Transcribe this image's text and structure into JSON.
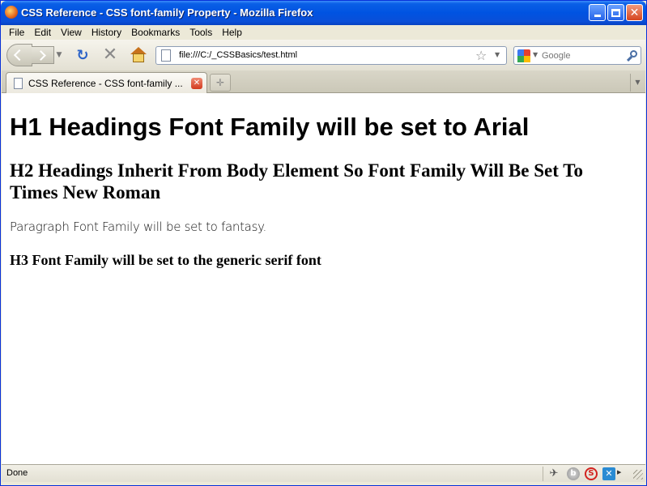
{
  "window": {
    "title": "CSS Reference - CSS font-family Property - Mozilla Firefox"
  },
  "menubar": {
    "items": [
      "File",
      "Edit",
      "View",
      "History",
      "Bookmarks",
      "Tools",
      "Help"
    ]
  },
  "navbar": {
    "url": "file:///C:/_CSSBasics/test.html",
    "search_placeholder": "Google",
    "search_engine_icon": "google-icon"
  },
  "tabs": [
    {
      "label": "CSS Reference - CSS font-family ...",
      "active": true
    }
  ],
  "content": {
    "h1": "H1 Headings Font Family will be set to Arial",
    "h2": "H2 Headings Inherit From Body Element So Font Family Will Be Set To Times New Roman",
    "paragraph": "Paragraph Font Family will be set to fantasy.",
    "h3": "H3 Font Family will be set to the generic serif font"
  },
  "statusbar": {
    "text": "Done"
  },
  "colors": {
    "titlebar": "#0053e1",
    "chrome": "#ece9d8",
    "close_button": "#d5451f"
  }
}
